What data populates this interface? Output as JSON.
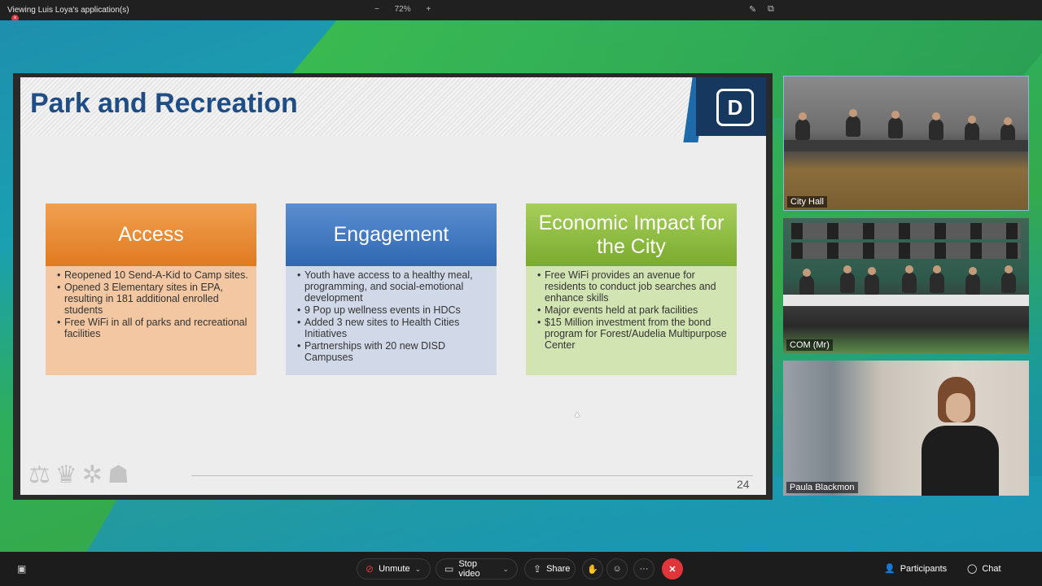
{
  "topbar": {
    "title": "Viewing Luis Loya's application(s)",
    "zoom_minus": "−",
    "zoom_level": "72%",
    "zoom_plus": "+"
  },
  "slide": {
    "title": "Park and Recreation",
    "logo_letter": "D",
    "page_number": "24",
    "columns": [
      {
        "heading": "Access",
        "bullets": [
          "Reopened 10 Send-A-Kid to Camp sites.",
          "Opened 3 Elementary sites in EPA, resulting in 181 additional enrolled students",
          "Free WiFi in all of parks and recreational facilities"
        ]
      },
      {
        "heading": "Engagement",
        "bullets": [
          "Youth have access to a healthy meal, programming, and social-emotional development",
          "9 Pop up wellness events in HDCs",
          "Added 3 new sites to Health Cities Initiatives",
          "Partnerships with 20 new DISD Campuses"
        ]
      },
      {
        "heading": "Economic Impact for the City",
        "bullets": [
          "Free WiFi provides an avenue for residents to conduct job searches and enhance skills",
          "Major events held at park facilities",
          "$15 Million investment from the bond program for Forest/Audelia Multipurpose Center"
        ]
      }
    ]
  },
  "video_tiles": [
    {
      "label": "City Hall"
    },
    {
      "label": "COM (Mr)"
    },
    {
      "label": "Paula Blackmon"
    }
  ],
  "toolbar": {
    "unmute_label": "Unmute",
    "stop_video_label": "Stop video",
    "share_label": "Share",
    "more_label": "···",
    "end_label": "✕",
    "participants_label": "Participants",
    "chat_label": "Chat"
  },
  "colors": {
    "slide_title": "#1f4e87",
    "access_head": "#e07a20",
    "engagement_head": "#2f68b2",
    "economic_head": "#7aaa2e",
    "end_button": "#e0353b"
  },
  "icons": [
    "mic-off-icon",
    "video-icon",
    "share-icon",
    "hand-icon",
    "reactions-icon",
    "more-icon",
    "end-call-icon",
    "participants-icon",
    "chat-icon",
    "layout-icon"
  ]
}
